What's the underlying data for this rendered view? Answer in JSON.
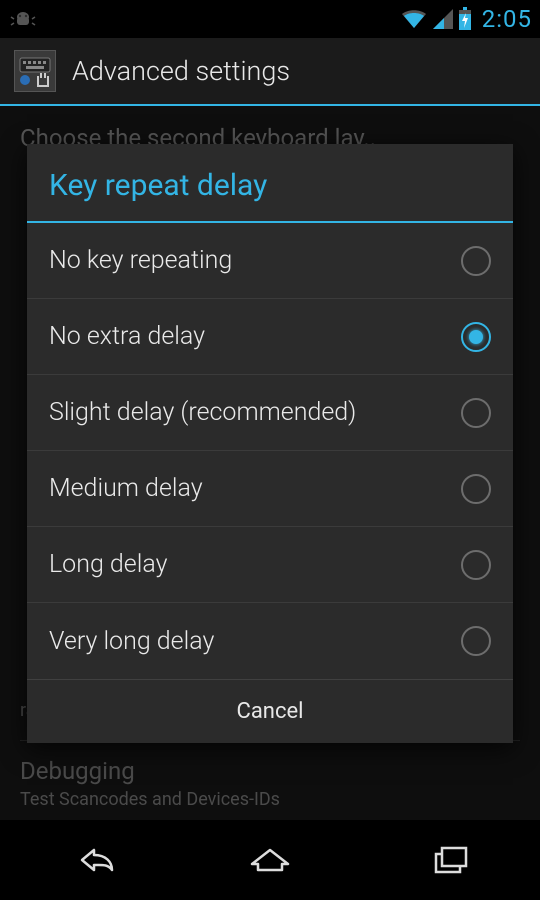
{
  "status_bar": {
    "clock": "2:05"
  },
  "action_bar": {
    "title": "Advanced settings"
  },
  "background": {
    "choose_row": "Choose the second keyboard lay..",
    "rate_tail": "rate a bit.",
    "debugging_header": "Debugging",
    "debugging_sub": "Test Scancodes and Devices-IDs"
  },
  "dialog": {
    "title": "Key repeat delay",
    "options": [
      {
        "label": "No key repeating",
        "selected": false
      },
      {
        "label": "No extra delay",
        "selected": true
      },
      {
        "label": "Slight delay (recommended)",
        "selected": false
      },
      {
        "label": "Medium delay",
        "selected": false
      },
      {
        "label": "Long delay",
        "selected": false
      },
      {
        "label": "Very long delay",
        "selected": false
      }
    ],
    "cancel": "Cancel"
  }
}
